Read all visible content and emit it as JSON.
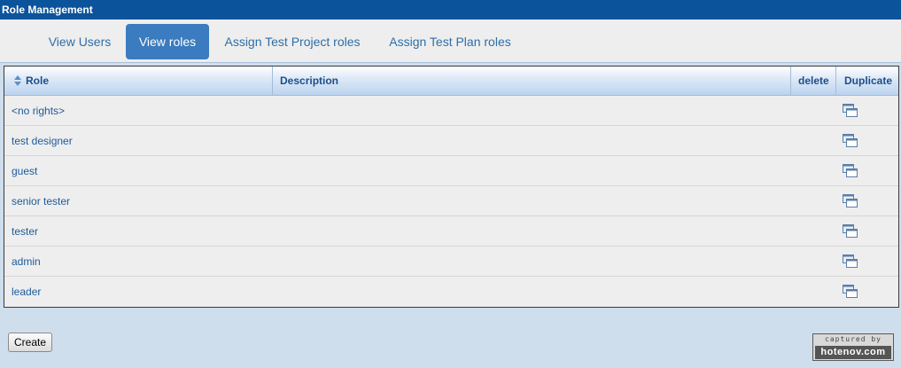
{
  "window": {
    "title": "Role Management"
  },
  "tabs": [
    {
      "label": "View Users",
      "active": false
    },
    {
      "label": "View roles",
      "active": true
    },
    {
      "label": "Assign Test Project roles",
      "active": false
    },
    {
      "label": "Assign Test Plan roles",
      "active": false
    }
  ],
  "table": {
    "columns": {
      "role": "Role",
      "description": "Description",
      "delete": "delete",
      "duplicate": "Duplicate"
    },
    "rows": [
      {
        "role": "<no rights>",
        "description": ""
      },
      {
        "role": "test designer",
        "description": ""
      },
      {
        "role": "guest",
        "description": ""
      },
      {
        "role": "senior tester",
        "description": ""
      },
      {
        "role": "tester",
        "description": ""
      },
      {
        "role": "admin",
        "description": ""
      },
      {
        "role": "leader",
        "description": ""
      }
    ],
    "duplicate_icon": "duplicate-icon",
    "sort_icon": "sort-icon"
  },
  "actions": {
    "create_label": "Create"
  },
  "watermark": {
    "top": "captured by",
    "bottom": "hotenov.com"
  },
  "colors": {
    "titlebar": "#0b539b",
    "active_tab": "#3b7bbf",
    "link": "#1d5a9a",
    "page_bg": "#cfdeed"
  }
}
